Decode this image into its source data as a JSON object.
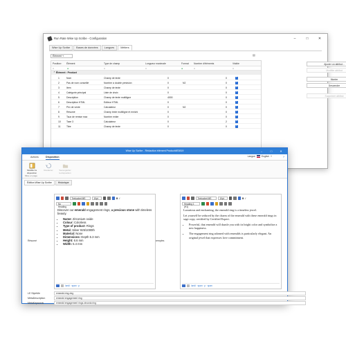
{
  "back_window": {
    "title": "Run Rate Wise Up Scribe - Configuration",
    "tabs": [
      "Wise Up Scribe",
      "Bases de données",
      "Langues",
      "Métiers"
    ],
    "active_tab": 3,
    "element_selector": "Élément",
    "columns": [
      "Position",
      "Élément",
      "Type de champ",
      "Longueur maximale",
      "Format",
      "Nombre d'éléments",
      "Visible"
    ],
    "group_label": "Élément : Product",
    "rows": [
      {
        "pos": "1",
        "name": "Nom",
        "type": "Champ de texte",
        "len": "0",
        "fmt": "",
        "count": "0"
      },
      {
        "pos": "2",
        "name": "Pas de nom conseillé",
        "type": "Nombre à double précision",
        "len": "0",
        "fmt": "N2",
        "count": "0"
      },
      {
        "pos": "3",
        "name": "Item",
        "type": "Champ de texte",
        "len": "0",
        "fmt": "",
        "count": "0"
      },
      {
        "pos": "4",
        "name": "Catégorie principal",
        "type": "Liste de choix",
        "len": "0",
        "fmt": "",
        "count": "0"
      },
      {
        "pos": "5",
        "name": "Description",
        "type": "Champ de texte multiligne",
        "len": "4000",
        "fmt": "",
        "count": "0"
      },
      {
        "pos": "6",
        "name": "Description HTML",
        "type": "Editeur HTML",
        "len": "0",
        "fmt": "",
        "count": "0"
      },
      {
        "pos": "7",
        "name": "Prix de vente",
        "type": "Calculateur",
        "len": "0",
        "fmt": "N2",
        "count": "0"
      },
      {
        "pos": "8",
        "name": "Résumé",
        "type": "Champ texte multiligne et enrichi",
        "len": "0",
        "fmt": "",
        "count": "0"
      },
      {
        "pos": "9",
        "name": "Taux de remise max",
        "type": "Nombre entier",
        "len": "0",
        "fmt": "",
        "count": "0"
      },
      {
        "pos": "10",
        "name": "Taxe 3",
        "type": "Calculateur",
        "len": "0",
        "fmt": "",
        "count": "2"
      },
      {
        "pos": "11",
        "name": "Titre",
        "type": "Champ de texte",
        "len": "0",
        "fmt": "",
        "count": "0"
      }
    ],
    "side_buttons": [
      {
        "label": "Ajouter un attribut...",
        "disabled": false
      },
      {
        "label": "Modifier attribut",
        "disabled": true
      },
      {
        "label": "Monter",
        "disabled": false
      },
      {
        "label": "Descendre",
        "disabled": false
      },
      {
        "label": "Supprimer attribut",
        "disabled": true
      }
    ]
  },
  "front_window": {
    "title": "Wise Up Scribe - Rédaction élément Product#E0819",
    "ribbon_tabs": [
      "Actions",
      "Disposition"
    ],
    "active_ribbon_tab": 1,
    "ribbon_buttons": [
      {
        "label": "Modifier la disposition",
        "disabled": false
      },
      {
        "label": "Restaurer",
        "disabled": true
      },
      {
        "label": "Sauvegarder la disposition",
        "disabled": true
      }
    ],
    "ribbon_group_label": "Mise en page",
    "language_label": "Langue",
    "language_value": "English",
    "doc_tabs": [
      "Édition Wise Up Scribe",
      "Historique"
    ],
    "resume_label": "Résumé",
    "example_label": "Exemples",
    "left_editor": {
      "font": "Trebuchet MS",
      "size": "10pt",
      "style": "No Heading",
      "intro_prefix": "Discover our ",
      "intro_bold": "emerald",
      "intro_mid": " engagement rings, ",
      "intro_bold2": "a precious stone",
      "intro_suffix": " with timeless beauty.",
      "bullets": [
        {
          "k": "Name:",
          "v": " Zirconium oxide"
        },
        {
          "k": "Colour:",
          "v": " Colorless"
        },
        {
          "k": "Type of product:",
          "v": " Rings"
        },
        {
          "k": "Metal:",
          "v": " Silver 925/1000th"
        },
        {
          "k": "Material:",
          "v": " None"
        },
        {
          "k": "Dimensions:",
          "v": " Depth 5.3 mm"
        },
        {
          "k": "Height:",
          "v": " 6.6 mm"
        },
        {
          "k": "Width:",
          "v": " 5.4 mm"
        }
      ],
      "footer": "lundi  ·  span  ·  p"
    },
    "right_editor": {
      "font": "Trebuchet MS",
      "size": "10pt",
      "style": "Heading 1 (H1)",
      "p1": "Luxurious and enchanting, the emerald ring is a timeless jewel.",
      "p2": "Let yourself be seduced by the charm of the emerald with these emerald rings in sage copy, certified by Certified Expert.",
      "bullets": [
        "Powerful, that emerald will dazzle you with its bright color and symbolize a new happiness.",
        "The engagement ring adorned with emeralds is particularly elegant. An original jewel that expresses love commitment."
      ],
      "footer": "lundi  ·  span  ·  p  ·  span"
    },
    "bottom_fields": [
      {
        "label": "LE StyleMe",
        "value": "emerald-ring-ring"
      },
      {
        "label": "MétaDescription",
        "value": "emerald engagement ring"
      },
      {
        "label": "MétaKeywords",
        "value": "emerald engagement rings zirconia ring"
      }
    ]
  }
}
